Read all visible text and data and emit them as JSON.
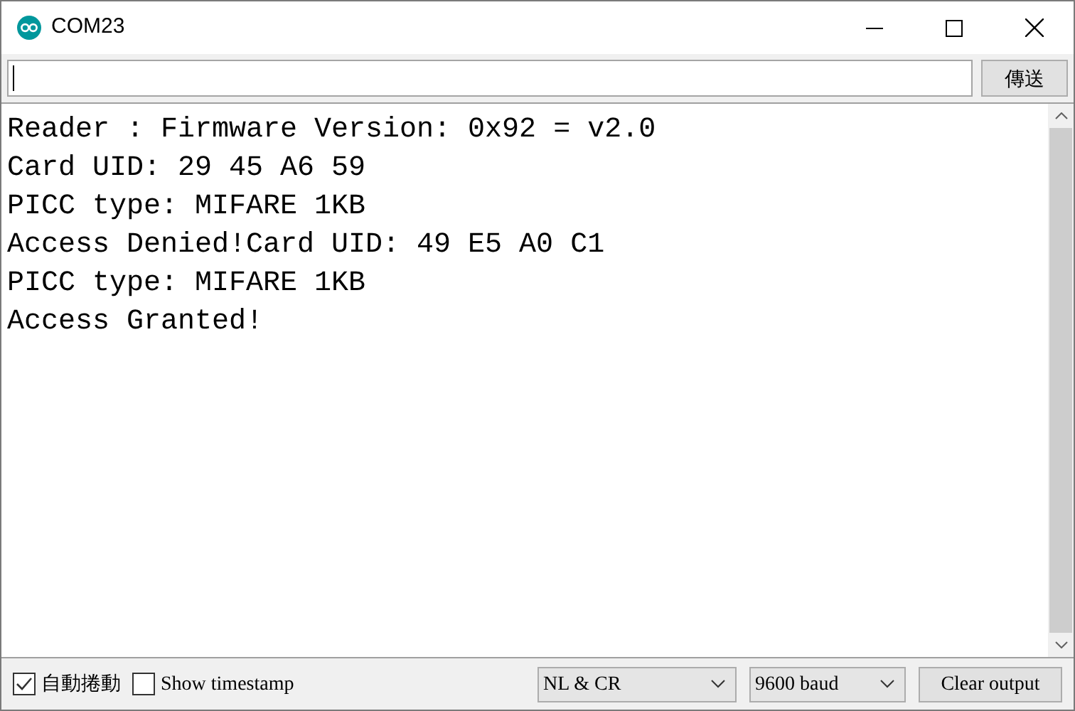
{
  "window": {
    "title": "COM23"
  },
  "send_bar": {
    "button": "傳送"
  },
  "output": {
    "lines": [
      "Reader : Firmware Version: 0x92 = v2.0",
      "Card UID: 29 45 A6 59",
      "PICC type: MIFARE 1KB",
      "Access Denied!Card UID: 49 E5 A0 C1",
      "PICC type: MIFARE 1KB",
      "Access Granted!"
    ]
  },
  "bottom_bar": {
    "checkboxes": [
      {
        "label": "自動捲動",
        "checked": true
      },
      {
        "label": "Show timestamp",
        "checked": false
      }
    ],
    "line_ending": "NL & CR",
    "baud": "9600 baud",
    "clear_button": "Clear output"
  }
}
